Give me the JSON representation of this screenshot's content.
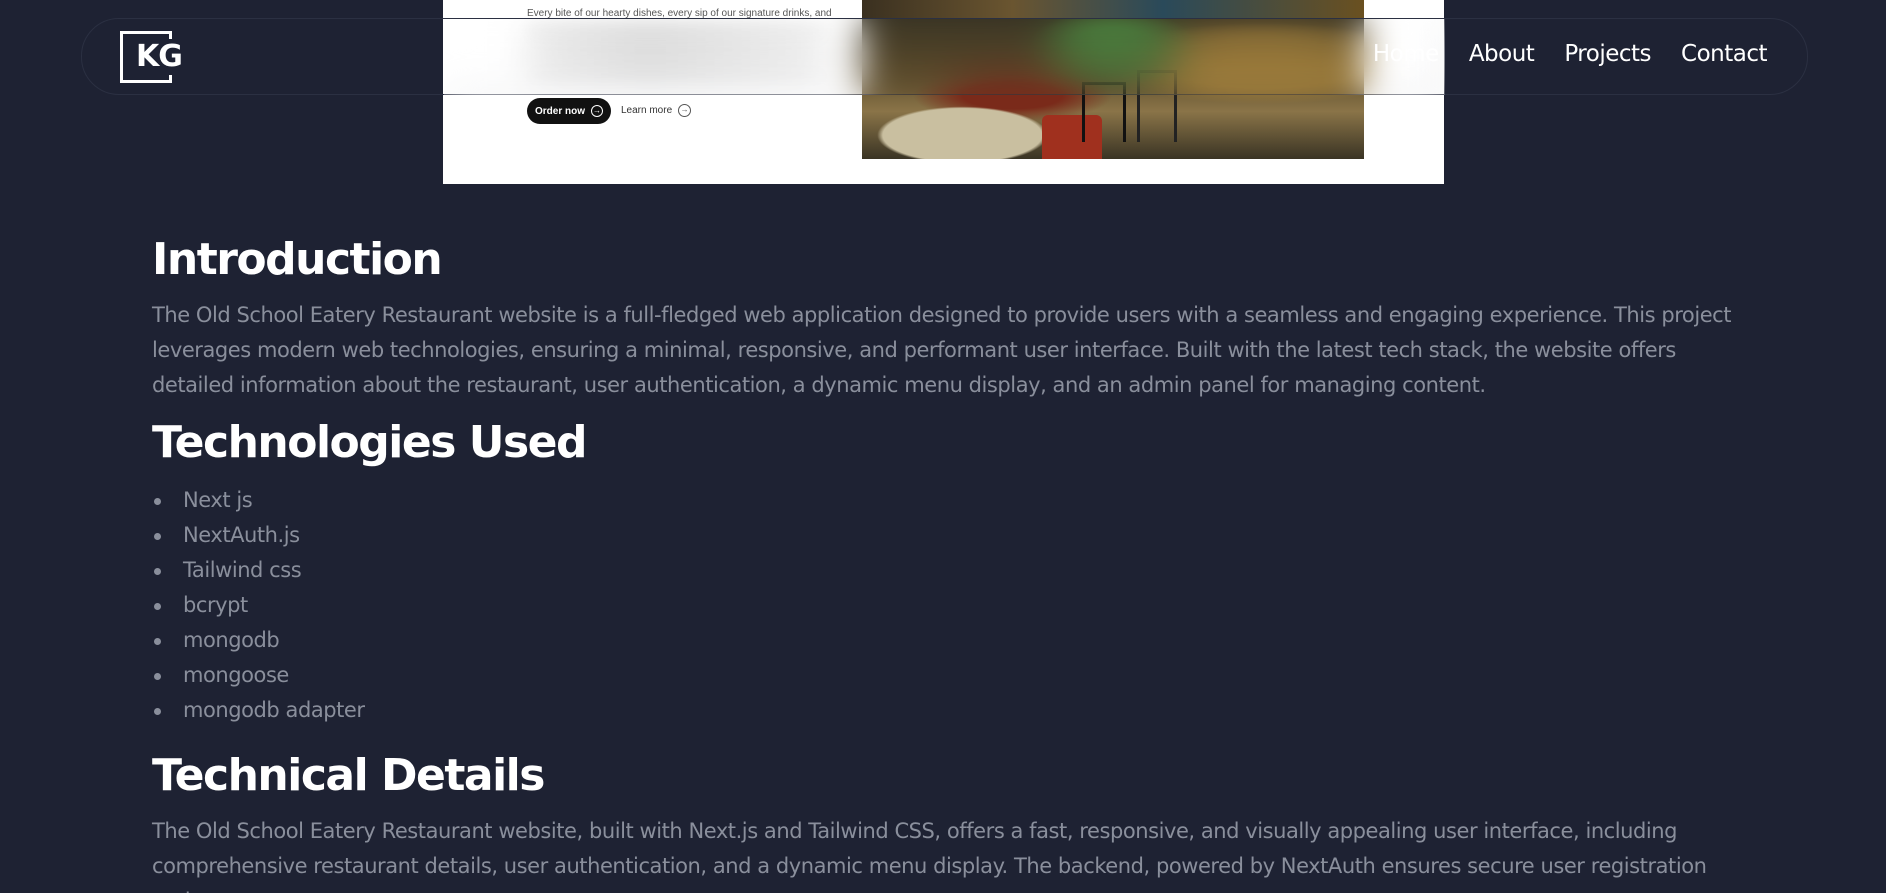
{
  "hero": {
    "tagline": "Every bite of our hearty dishes, every sip of our signature drinks, and",
    "order_button": "Order now",
    "learn_button": "Learn more"
  },
  "nav": {
    "logo": "KG",
    "links": [
      "Home",
      "About",
      "Projects",
      "Contact"
    ]
  },
  "sections": {
    "intro": {
      "heading": "Introduction",
      "text": "The Old School Eatery Restaurant website is a full-fledged web application designed to provide users with a seamless and engaging experience. This project leverages modern web technologies, ensuring a minimal, responsive, and performant user interface. Built with the latest tech stack, the website offers detailed information about the restaurant, user authentication, a dynamic menu display, and an admin panel for managing content."
    },
    "tech": {
      "heading": "Technologies Used",
      "items": [
        "Next js",
        "NextAuth.js",
        "Tailwind css",
        "bcrypt",
        "mongodb",
        "mongoose",
        "mongodb adapter"
      ]
    },
    "details": {
      "heading": "Technical Details",
      "text": "The Old School Eatery Restaurant website, built with Next.js and Tailwind CSS, offers a fast, responsive, and visually appealing user interface, including comprehensive restaurant details, user authentication, and a dynamic menu display. The backend, powered by NextAuth ensures secure user registration and"
    }
  }
}
